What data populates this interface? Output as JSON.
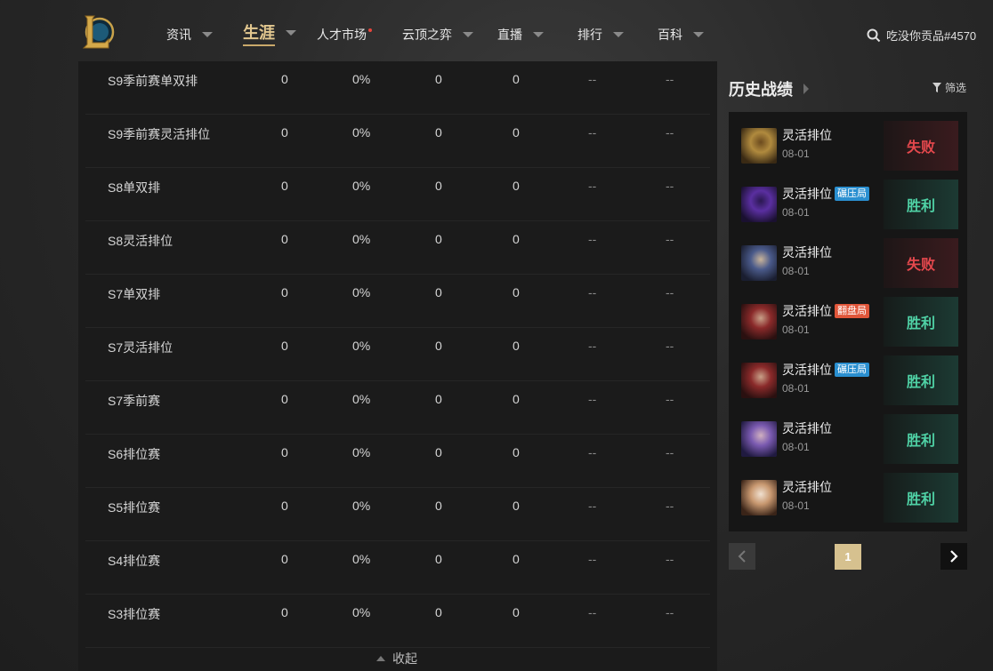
{
  "nav": {
    "items": [
      {
        "label": "资讯",
        "active": false,
        "dot": false,
        "caret": true
      },
      {
        "label": "生涯",
        "active": true,
        "dot": false,
        "caret": true
      },
      {
        "label": "人才市场",
        "active": false,
        "dot": true,
        "caret": false
      },
      {
        "label": "云顶之弈",
        "active": false,
        "dot": false,
        "caret": true
      },
      {
        "label": "直播",
        "active": false,
        "dot": false,
        "caret": true
      },
      {
        "label": "排行",
        "active": false,
        "dot": false,
        "caret": true
      },
      {
        "label": "百科",
        "active": false,
        "dot": false,
        "caret": true
      }
    ],
    "search_text": "吃没你贡品#4570"
  },
  "table": {
    "rows": [
      {
        "name": "S9季前赛单双排",
        "c1": "0",
        "c2": "0%",
        "c3": "0",
        "c4": "0",
        "c5": "--",
        "c6": "--"
      },
      {
        "name": "S9季前赛灵活排位",
        "c1": "0",
        "c2": "0%",
        "c3": "0",
        "c4": "0",
        "c5": "--",
        "c6": "--"
      },
      {
        "name": "S8单双排",
        "c1": "0",
        "c2": "0%",
        "c3": "0",
        "c4": "0",
        "c5": "--",
        "c6": "--"
      },
      {
        "name": "S8灵活排位",
        "c1": "0",
        "c2": "0%",
        "c3": "0",
        "c4": "0",
        "c5": "--",
        "c6": "--"
      },
      {
        "name": "S7单双排",
        "c1": "0",
        "c2": "0%",
        "c3": "0",
        "c4": "0",
        "c5": "--",
        "c6": "--"
      },
      {
        "name": "S7灵活排位",
        "c1": "0",
        "c2": "0%",
        "c3": "0",
        "c4": "0",
        "c5": "--",
        "c6": "--"
      },
      {
        "name": "S7季前赛",
        "c1": "0",
        "c2": "0%",
        "c3": "0",
        "c4": "0",
        "c5": "--",
        "c6": "--"
      },
      {
        "name": "S6排位赛",
        "c1": "0",
        "c2": "0%",
        "c3": "0",
        "c4": "0",
        "c5": "--",
        "c6": "--"
      },
      {
        "name": "S5排位赛",
        "c1": "0",
        "c2": "0%",
        "c3": "0",
        "c4": "0",
        "c5": "--",
        "c6": "--"
      },
      {
        "name": "S4排位赛",
        "c1": "0",
        "c2": "0%",
        "c3": "0",
        "c4": "0",
        "c5": "--",
        "c6": "--"
      },
      {
        "name": "S3排位赛",
        "c1": "0",
        "c2": "0%",
        "c3": "0",
        "c4": "0",
        "c5": "--",
        "c6": "--"
      }
    ],
    "collapse_label": "收起"
  },
  "history": {
    "title": "历史战绩",
    "filter_label": "筛选",
    "matches": [
      {
        "mode": "灵活排位",
        "tag": "",
        "tag_color": "",
        "date": "08-01",
        "result": "失败",
        "win": false,
        "avatar_colors": [
          "#3a2a14",
          "#b08a3e",
          "#6b4a1e"
        ]
      },
      {
        "mode": "灵活排位",
        "tag": "碾压局",
        "tag_color": "#2a8fd0",
        "date": "08-01",
        "result": "胜利",
        "win": true,
        "avatar_colors": [
          "#1a1030",
          "#5a2fa0",
          "#2a1850"
        ]
      },
      {
        "mode": "灵活排位",
        "tag": "",
        "tag_color": "",
        "date": "08-01",
        "result": "失败",
        "win": false,
        "avatar_colors": [
          "#1a1e30",
          "#4a5a8a",
          "#c9b49a"
        ]
      },
      {
        "mode": "灵活排位",
        "tag": "翻盘局",
        "tag_color": "#e0563a",
        "date": "08-01",
        "result": "胜利",
        "win": true,
        "avatar_colors": [
          "#2a1010",
          "#8a2a2a",
          "#c8a088"
        ]
      },
      {
        "mode": "灵活排位",
        "tag": "碾压局",
        "tag_color": "#2a8fd0",
        "date": "08-01",
        "result": "胜利",
        "win": true,
        "avatar_colors": [
          "#2a1010",
          "#8a2a2a",
          "#c8a088"
        ]
      },
      {
        "mode": "灵活排位",
        "tag": "",
        "tag_color": "",
        "date": "08-01",
        "result": "胜利",
        "win": true,
        "avatar_colors": [
          "#201a40",
          "#7a5ab0",
          "#d0b0c0"
        ]
      },
      {
        "mode": "灵活排位",
        "tag": "",
        "tag_color": "",
        "date": "08-01",
        "result": "胜利",
        "win": true,
        "avatar_colors": [
          "#3a2418",
          "#c89870",
          "#f0e0d0"
        ]
      }
    ]
  },
  "pager": {
    "current_page": "1"
  }
}
